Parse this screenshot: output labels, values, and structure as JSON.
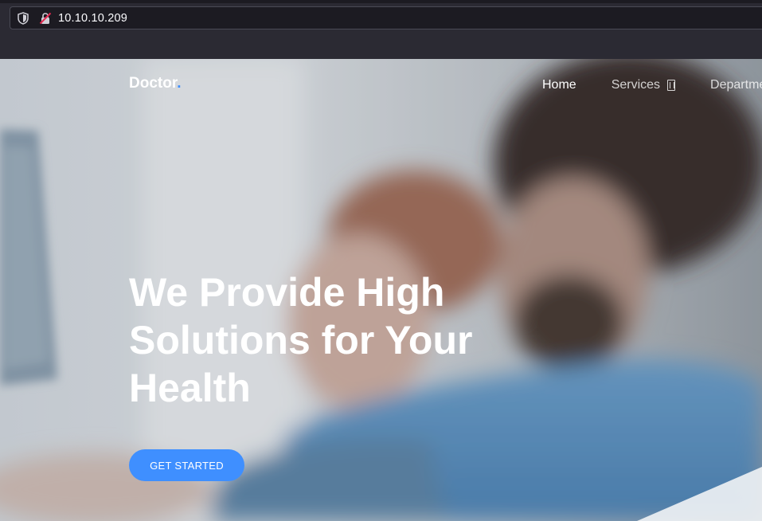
{
  "browser": {
    "url": "10.10.10.209"
  },
  "site": {
    "logo_text": "Doctor",
    "logo_dot": ".",
    "accent_color": "#3f8fff",
    "nav": [
      {
        "label": "Home",
        "active": true
      },
      {
        "label": "Services",
        "active": false,
        "icon": "dropdown-icon"
      },
      {
        "label": "Department",
        "active": false
      }
    ]
  },
  "hero": {
    "title_lines": [
      "We Provide High",
      "Solutions for Your",
      "Health"
    ],
    "cta_label": "GET STARTED"
  }
}
